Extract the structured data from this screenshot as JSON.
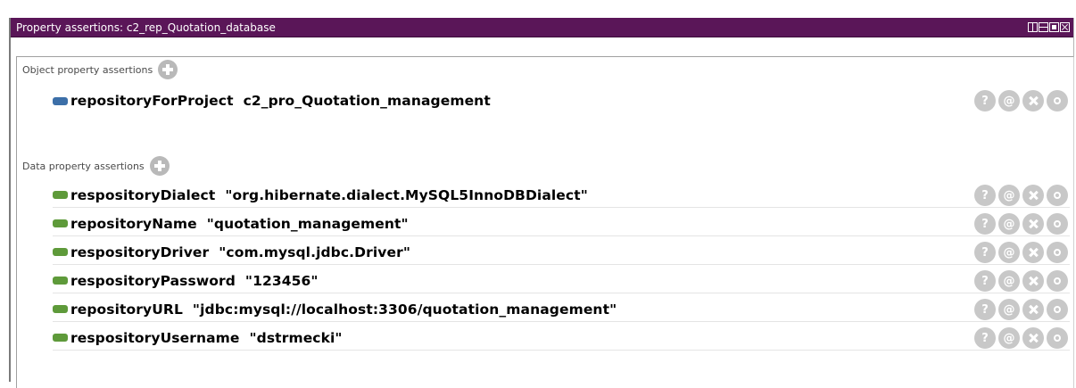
{
  "window": {
    "title": "Property assertions: c2_rep_Quotation_database"
  },
  "object_section": {
    "label": "Object property assertions",
    "add_icon": "add-circle-icon",
    "items": [
      {
        "text": "repositoryForProject  c2_pro_Quotation_management",
        "icon": "object-property-icon"
      }
    ]
  },
  "data_section": {
    "label": "Data property assertions",
    "add_icon": "add-circle-icon",
    "items": [
      {
        "text": "respositoryDialect  \"org.hibernate.dialect.MySQL5InnoDBDialect\"",
        "icon": "data-property-icon"
      },
      {
        "text": "repositoryName  \"quotation_management\"",
        "icon": "data-property-icon"
      },
      {
        "text": "respositoryDriver  \"com.mysql.jdbc.Driver\"",
        "icon": "data-property-icon"
      },
      {
        "text": "respositoryPassword  \"123456\"",
        "icon": "data-property-icon"
      },
      {
        "text": "repositoryURL  \"jdbc:mysql://localhost:3306/quotation_management\"",
        "icon": "data-property-icon"
      },
      {
        "text": "respositoryUsername  \"dstrmecki\"",
        "icon": "data-property-icon"
      }
    ]
  },
  "actions": {
    "help": "?",
    "annotate": "@"
  },
  "colors": {
    "titlebar": "#5a1658",
    "object_property": "#3c6fa8",
    "data_property": "#5e9a3a",
    "action_button": "#c8c8c8"
  }
}
